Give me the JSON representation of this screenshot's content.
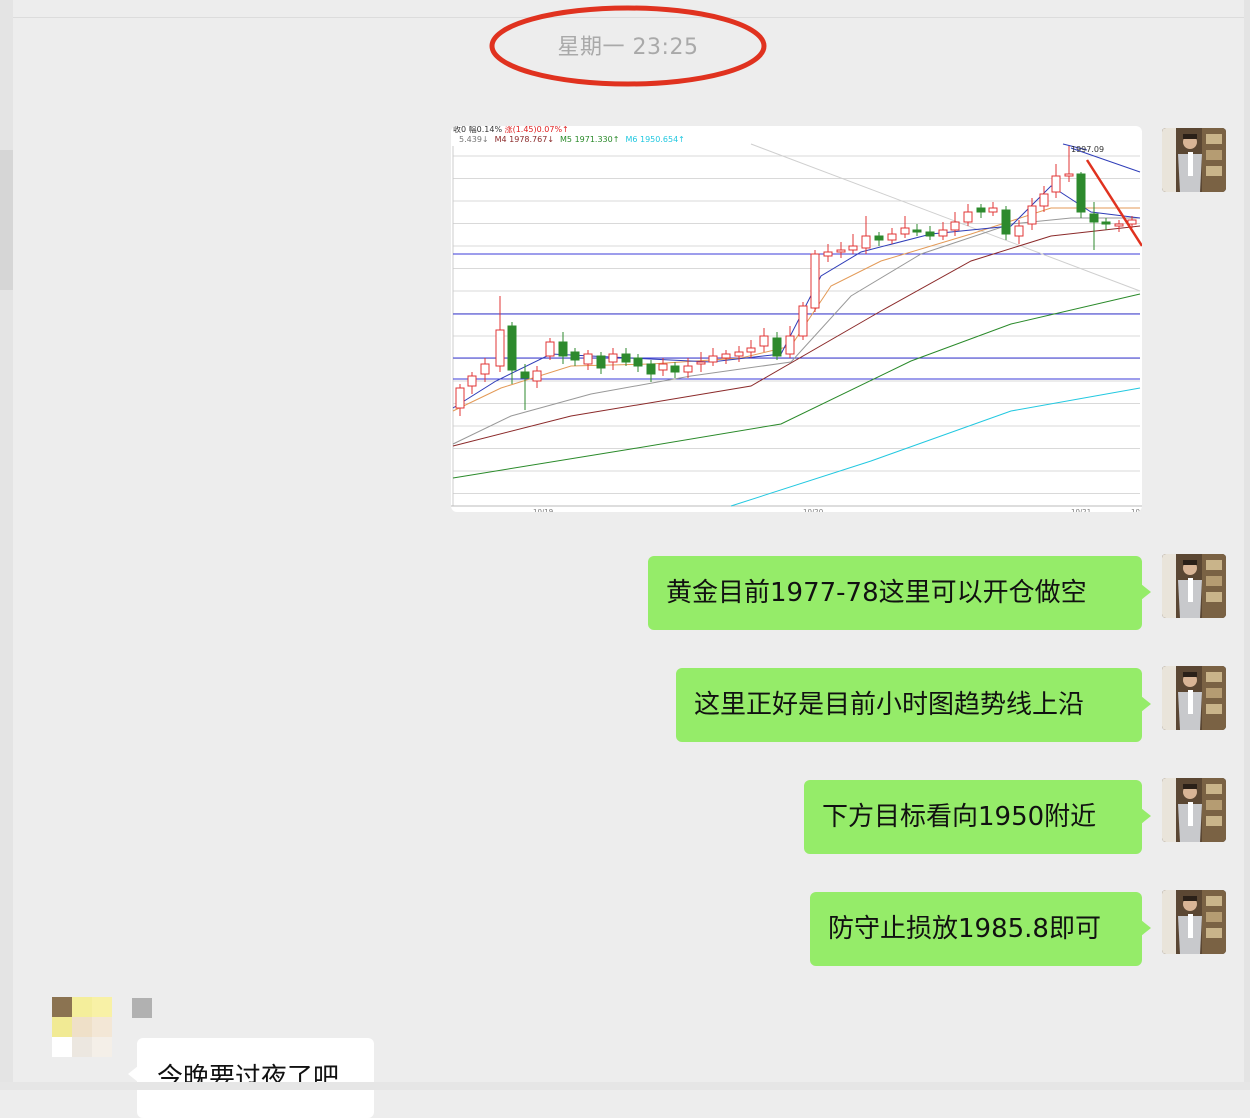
{
  "timestamp": "星期一 23:25",
  "chart_image": {
    "header_line1": [
      {
        "text": "收0 幅0.14% ",
        "color": "#333333"
      },
      {
        "text": "涨(1.45)0.07%↑",
        "color": "#e02020"
      }
    ],
    "header_line2": [
      {
        "text": "5.439↓",
        "color": "#777777"
      },
      {
        "text": "M4 1978.767↓",
        "color": "#8b2a2a"
      },
      {
        "text": "M5 1971.330↑",
        "color": "#2a8a2a"
      },
      {
        "text": "M6 1950.654↑",
        "color": "#22c8e0"
      }
    ],
    "peak_label": "1997.09",
    "date_labels": [
      "10/19",
      "10/20",
      "10/21",
      "10/"
    ]
  },
  "messages": [
    {
      "text": "黄金目前1977-78这里可以开仓做空"
    },
    {
      "text": "这里正好是目前小时图趋势线上沿"
    },
    {
      "text": "下方目标看向1950附近"
    },
    {
      "text": "防守止损放1985.8即可"
    }
  ],
  "incoming": {
    "text": "今晚要过夜了吧"
  },
  "colors": {
    "self_bubble": "#95ec69",
    "background": "#ededed",
    "annotation": "#e0321f"
  }
}
